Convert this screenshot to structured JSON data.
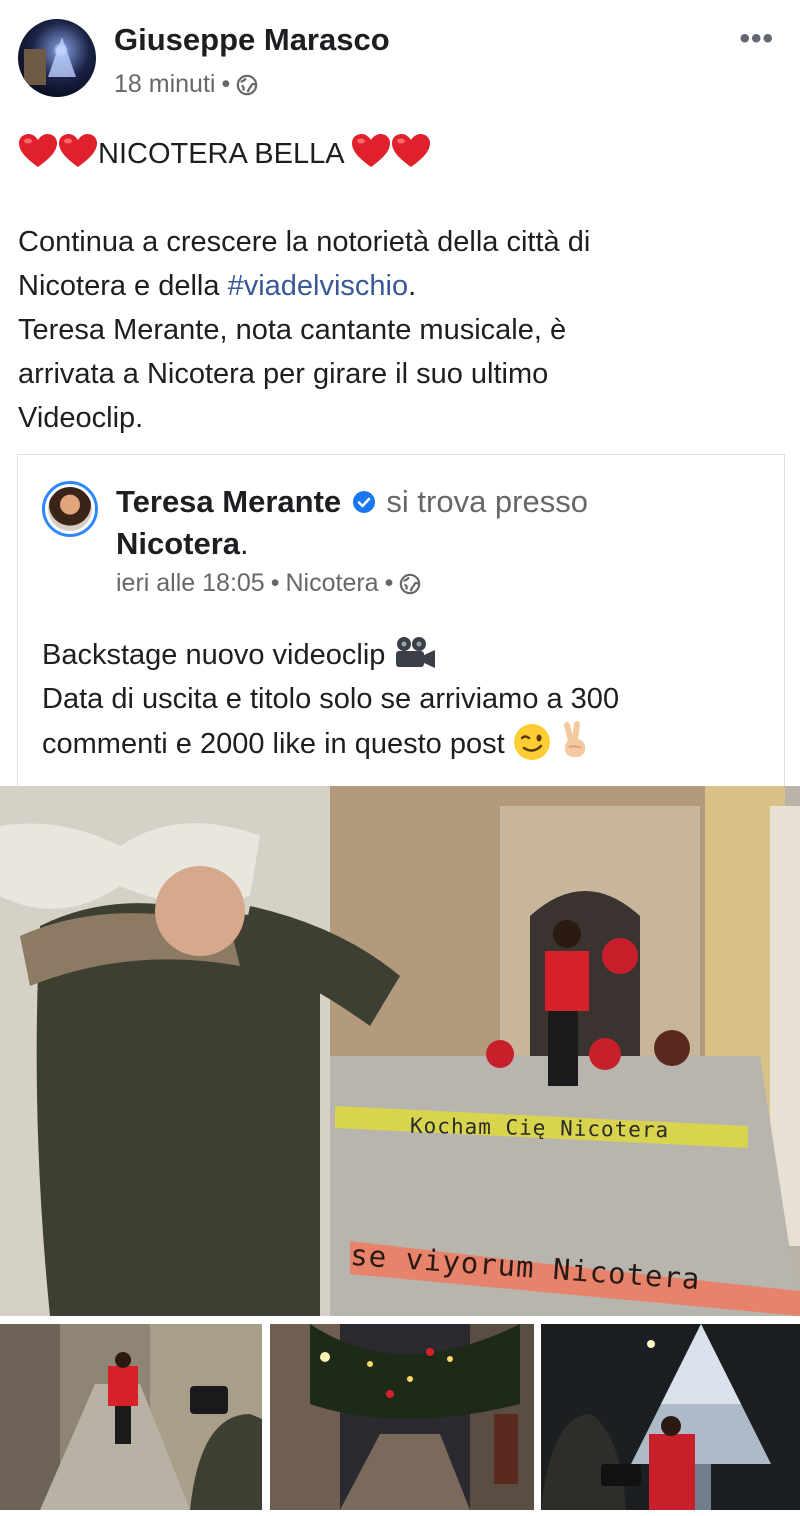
{
  "post": {
    "author": "Giuseppe Marasco",
    "time": "18 minuti",
    "separator": "•",
    "privacy_icon": "globe-icon",
    "more_icon": "more-options-icon",
    "more_label": "•••",
    "title_text": "NICOTERA BELLA ",
    "body_line1": "Continua  a crescere  la notorietà della città  di",
    "body_line2_pre": "Nicotera  e della ",
    "hashtag": "#viadelvischio",
    "body_line2_post": ".",
    "body_line3": "Teresa Merante, nota  cantante musicale, è",
    "body_line4": "arrivata  a Nicotera per girare  il suo  ultimo",
    "body_line5": "Videoclip."
  },
  "shared": {
    "author": "Teresa Merante",
    "location_intro": " si trova presso",
    "location": "Nicotera",
    "location_period": ".",
    "time": "ieri alle 18:05",
    "separator": "•",
    "place": "Nicotera",
    "line1": "Backstage nuovo videoclip ",
    "line2": "Data di uscita e titolo solo se arriviamo a 300",
    "line3": "commenti e 2000 like in questo post "
  },
  "photos": {
    "banner_top": "Kocham Cię Nicotera",
    "banner_bottom": "se viyorum Nicotera"
  },
  "colors": {
    "link": "#385898",
    "verified": "#1877f2",
    "secondary_text": "#65676b",
    "heart": "#e0202a"
  }
}
